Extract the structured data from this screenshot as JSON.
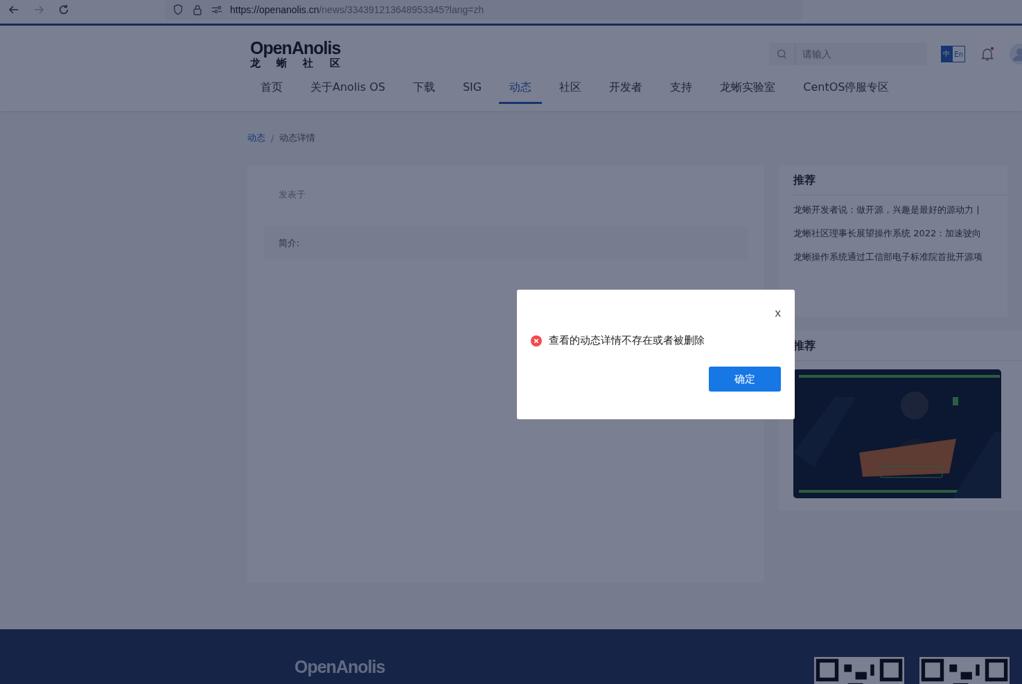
{
  "browser": {
    "url_host": "https://openanolis.cn",
    "url_path": "/news/334391213648953345?lang=zh"
  },
  "header": {
    "logo_text": "OpenAnolis",
    "logo_subtitle": "龙 蜥 社 区",
    "search": {
      "placeholder": "请输入"
    },
    "lang_icon": [
      {
        "label": "中",
        "selected": true
      },
      {
        "label": "En",
        "selected": false
      }
    ],
    "notification_dot": true
  },
  "nav": [
    {
      "label": "首页",
      "selected": false
    },
    {
      "label": "关于Anolis OS",
      "selected": false
    },
    {
      "label": "下载",
      "selected": false
    },
    {
      "label": "SIG",
      "selected": false
    },
    {
      "label": "动态",
      "selected": true
    },
    {
      "label": "社区",
      "selected": false
    },
    {
      "label": "开发者",
      "selected": false
    },
    {
      "label": "支持",
      "selected": false
    },
    {
      "label": "龙蜥实验室",
      "selected": false
    },
    {
      "label": "CentOS停服专区",
      "selected": false
    }
  ],
  "breadcrumb": [
    {
      "label": "动态",
      "kind": "link"
    },
    {
      "label": "动态详情",
      "kind": "current"
    }
  ],
  "breadcrumb_separator": "/",
  "article": {
    "published_label": "发表于",
    "summary_label": "简介:"
  },
  "sidebar": [
    {
      "title": "推荐",
      "kind": "links",
      "items": [
        "龙蜥开发者说：做开源，兴趣是最好的源动力 |",
        "龙蜥社区理事长展望操作系统 2022：加速驶向",
        "龙蜥操作系统通过工信部电子标准院首批开源项"
      ]
    },
    {
      "title": "推荐",
      "kind": "banner"
    }
  ],
  "footer": {
    "logo_text": "OpenAnolis"
  },
  "dialog": {
    "close": "x",
    "message": "查看的动态详情不存在或者被删除",
    "confirm": "确定"
  }
}
